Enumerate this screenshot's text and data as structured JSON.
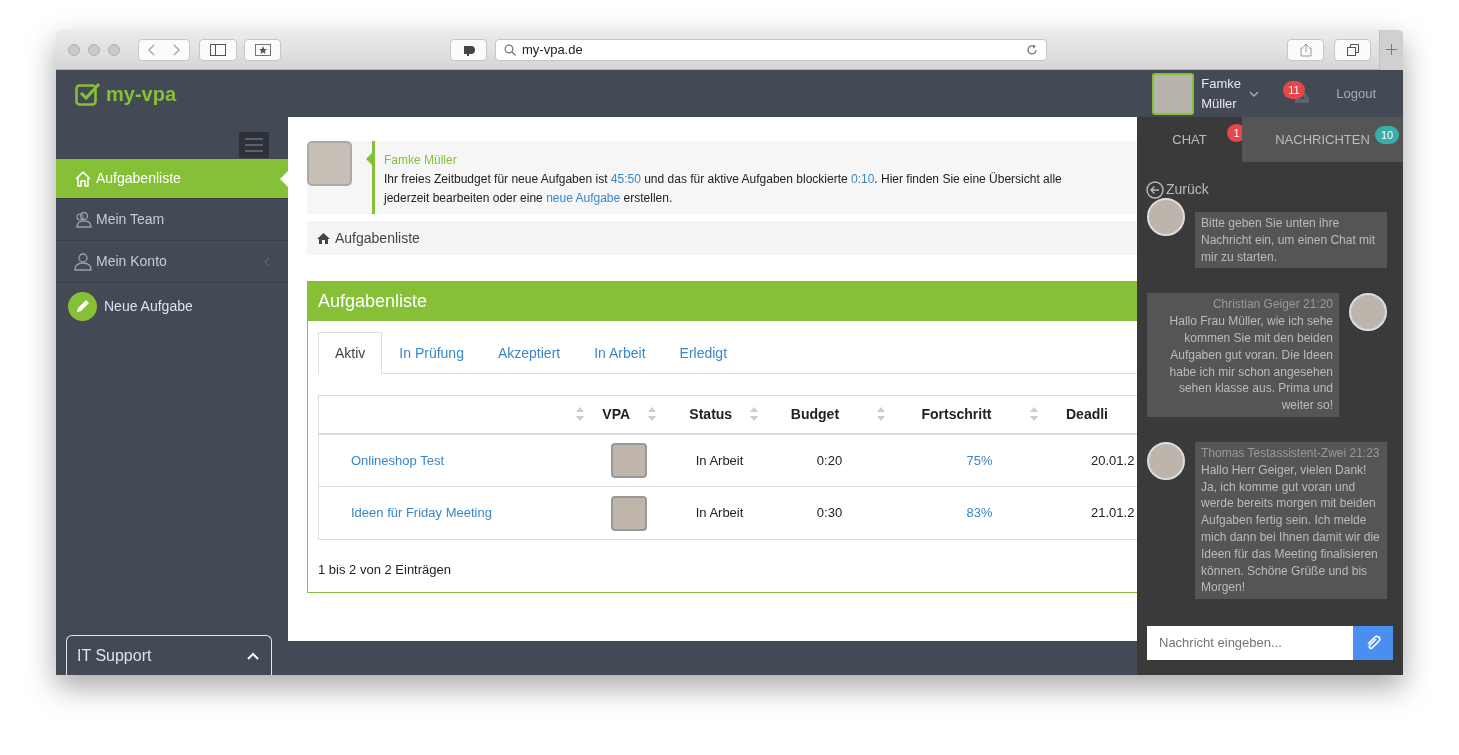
{
  "browser": {
    "url": "my-vpa.de"
  },
  "header": {
    "logo": "my-vpa",
    "user_name": "Famke Müller",
    "notification_count": "11",
    "logout": "Logout"
  },
  "sidebar": {
    "items": [
      {
        "kind": "nav",
        "label": "Aufgabenliste",
        "selected": true,
        "has_submenu": false
      },
      {
        "kind": "nav",
        "label": "Mein Team",
        "selected": false,
        "has_submenu": false
      },
      {
        "kind": "nav",
        "label": "Mein Konto",
        "selected": false,
        "has_submenu": true
      },
      {
        "kind": "action",
        "label": "Neue Aufgabe",
        "selected": false,
        "has_submenu": false
      }
    ],
    "support": {
      "label": "IT Support"
    }
  },
  "intro": {
    "name": "Famke Müller",
    "lines": [
      [
        {
          "text": "Ihr freies Zeitbudget für neue Aufgaben ist "
        },
        {
          "link": "45:50"
        },
        {
          "text": " und das für aktive Aufgaben blockierte "
        },
        {
          "link": "0:10"
        },
        {
          "text": ". Hier finden Sie eine Übersicht alle"
        }
      ],
      [
        {
          "text": "jederzeit bearbeiten oder eine "
        },
        {
          "link": "neue Aufgabe"
        },
        {
          "text": " erstellen."
        }
      ]
    ]
  },
  "breadcrumb": "Aufgabenliste",
  "card": {
    "title": "Aufgabenliste",
    "tabs": [
      {
        "label": "Aktiv",
        "selected": true
      },
      {
        "label": "In Prüfung",
        "selected": false
      },
      {
        "label": "Akzeptiert",
        "selected": false
      },
      {
        "label": "In Arbeit",
        "selected": false
      },
      {
        "label": "Erledigt",
        "selected": false
      }
    ],
    "table": {
      "columns": [
        {
          "sortable": true
        },
        {
          "label": "VPA",
          "sortable": true
        },
        {
          "label": "Status",
          "sortable": true
        },
        {
          "label": "Budget",
          "sortable": true
        },
        {
          "label": "Fortschritt",
          "sortable": true
        },
        {
          "label": "Deadli",
          "sortable": false
        }
      ],
      "rows": [
        {
          "task": "Onlineshop Test",
          "status": "In Arbeit",
          "budget": "0:20",
          "progress": "75%",
          "deadline": "20.01.2"
        },
        {
          "task": "Ideen für Friday Meeting",
          "status": "In Arbeit",
          "budget": "0:30",
          "progress": "83%",
          "deadline": "21.01.2"
        }
      ]
    },
    "footer": "1 bis 2 von 2 Einträgen"
  },
  "chat": {
    "tabs": [
      {
        "label": "CHAT",
        "badge": "1",
        "color": "#e8474a",
        "selected": true
      },
      {
        "label": "NACHRICHTEN",
        "badge": "10",
        "color": "#3aafa9",
        "selected": false
      }
    ],
    "back": "Zurück",
    "messages": [
      {
        "kind": "incoming",
        "text": "Bitte geben Sie unten ihre Nachricht ein, um einen Chat mit mir zu starten."
      },
      {
        "kind": "outgoing",
        "meta": "Christian Geiger 21:20",
        "text": "Hallo Frau Müller, wie ich sehe kommen Sie mit den beiden Aufgaben gut voran. Die Ideen habe ich mir schon angesehen sehen klasse aus. Prima und weiter so!"
      },
      {
        "kind": "incoming",
        "meta": "Thomas Testassistent-Zwei 21:23",
        "text": "Hallo Herr Geiger, vielen Dank! Ja, ich komme gut voran und werde bereits morgen mit beiden Aufgaben fertig sein. Ich melde mich dann bei Ihnen damit wir die Ideen für das Meeting finalisieren können. Schöne Grüße und bis Morgen!"
      }
    ],
    "input": {
      "placeholder": "Nachricht eingeben..."
    }
  }
}
